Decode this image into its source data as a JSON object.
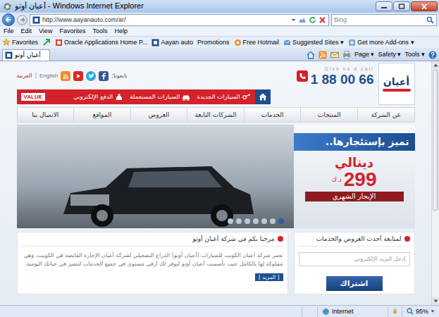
{
  "window": {
    "title": "أعيان أوتو - Windows Internet Explorer"
  },
  "address_bar": {
    "url": "http://www.aayanauto.com/ar/",
    "search_placeholder": "Bing"
  },
  "menu_bar": [
    "File",
    "Edit",
    "View",
    "Favorites",
    "Tools",
    "Help"
  ],
  "favorites_bar": {
    "label": "Favorites",
    "items": [
      "Oracle Applications Home P...",
      "Aayan auto",
      "Promotions",
      "Free Hotmail",
      "Suggested Sites ▾",
      "Get more Add-ons ▾"
    ]
  },
  "tabs": [
    {
      "label": "أعيان أوتو",
      "selected": true
    }
  ],
  "command_bar": [
    "Page ▾",
    "Safety ▾",
    "Tools ▾"
  ],
  "site": {
    "logo": "أعيان",
    "call_label": "Give us a call",
    "phone": "1 88 00 66",
    "follow_label": "تابعونا:",
    "languages": [
      {
        "label": "English",
        "selected": false
      },
      {
        "label": "العربية",
        "selected": true
      }
    ],
    "language_separator": "|",
    "quick_links": [
      "السيارات الجديدة",
      "السيارات المستعملة",
      "الدفع الإلكتروني"
    ],
    "value_badge": "VALUE",
    "nav": [
      "عن الشركة",
      "المنتجات",
      "الخدمات",
      "الشركات التابعة",
      "العروض",
      "المواقع",
      "الاتصال بنا"
    ],
    "banner": {
      "slogan": "تميز بإستئجارها..",
      "model": "دينالي",
      "price": "299",
      "currency": "د.ك",
      "price_label": "الإيجار الشهري",
      "slides": [
        {
          "selected": true
        },
        {
          "selected": false
        },
        {
          "selected": false
        },
        {
          "selected": false
        },
        {
          "selected": false
        },
        {
          "selected": false
        },
        {
          "selected": false
        }
      ]
    },
    "welcome": {
      "title": "مرحبا بكم في شركة أعيان أوتو",
      "text": "تعتبر شركة أعيان الكويت للسيارات (أعيان أوتو) الذراع التشغيلي لشركة أعيان الإجارة القابضة في الكويت، وهي مملوكة لها بالكامل حيث تأسست أعيان أوتو لتوفر لك أرقى مستوى في جميع الخدمات لتتميز في حياتك اليومية.",
      "more": "[ المزيد ]"
    },
    "subscribe": {
      "title": "لمتابعة أحدث العروض والخدمات",
      "placeholder": "إدخل البريد الإلكتروني",
      "button": "اشتراك"
    }
  },
  "status_bar": {
    "zone": "Internet",
    "zoom": "95%"
  }
}
